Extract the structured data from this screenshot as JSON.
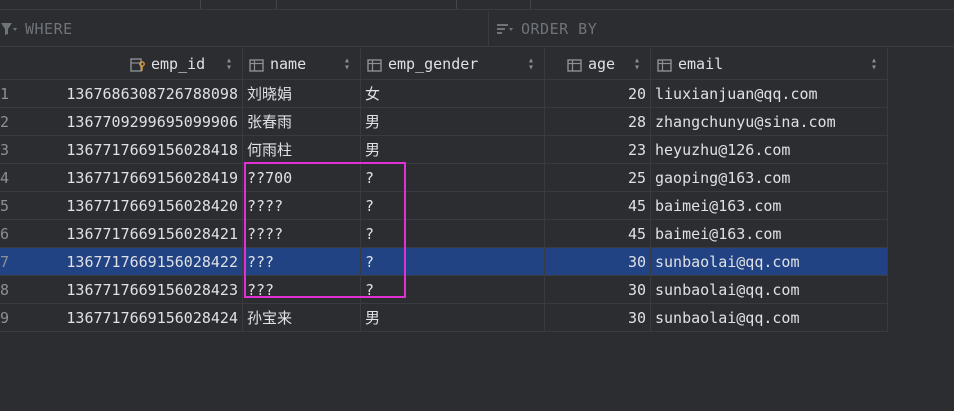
{
  "filters": {
    "where_label": "WHERE",
    "order_by_label": "ORDER BY"
  },
  "columns": [
    {
      "label": "emp_id",
      "icon": "key-column-icon"
    },
    {
      "label": "name",
      "icon": "column-icon"
    },
    {
      "label": "emp_gender",
      "icon": "column-icon"
    },
    {
      "label": "age",
      "icon": "column-icon"
    },
    {
      "label": "email",
      "icon": "column-icon"
    }
  ],
  "rows": [
    {
      "num": "1",
      "emp_id": "1367686308726788098",
      "name": "刘晓娟",
      "gender": "女",
      "age": "20",
      "email": "liuxianjuan@qq.com"
    },
    {
      "num": "2",
      "emp_id": "1367709299695099906",
      "name": "张春雨",
      "gender": "男",
      "age": "28",
      "email": "zhangchunyu@sina.com"
    },
    {
      "num": "3",
      "emp_id": "1367717669156028418",
      "name": "何雨柱",
      "gender": "男",
      "age": "23",
      "email": "heyuzhu@126.com"
    },
    {
      "num": "4",
      "emp_id": "1367717669156028419",
      "name": "??700",
      "gender": "?",
      "age": "25",
      "email": "gaoping@163.com"
    },
    {
      "num": "5",
      "emp_id": "1367717669156028420",
      "name": "????",
      "gender": "?",
      "age": "45",
      "email": "baimei@163.com"
    },
    {
      "num": "6",
      "emp_id": "1367717669156028421",
      "name": "????",
      "gender": "?",
      "age": "45",
      "email": "baimei@163.com"
    },
    {
      "num": "7",
      "emp_id": "1367717669156028422",
      "name": "???",
      "gender": "?",
      "age": "30",
      "email": "sunbaolai@qq.com"
    },
    {
      "num": "8",
      "emp_id": "1367717669156028423",
      "name": "???",
      "gender": "?",
      "age": "30",
      "email": "sunbaolai@qq.com"
    },
    {
      "num": "9",
      "emp_id": "1367717669156028424",
      "name": "孙宝来",
      "gender": "男",
      "age": "30",
      "email": "sunbaolai@qq.com"
    }
  ],
  "selected_row": 7,
  "colors": {
    "selection": "#214283",
    "annotation_box": "#e030d6",
    "background": "#2b2d30"
  }
}
